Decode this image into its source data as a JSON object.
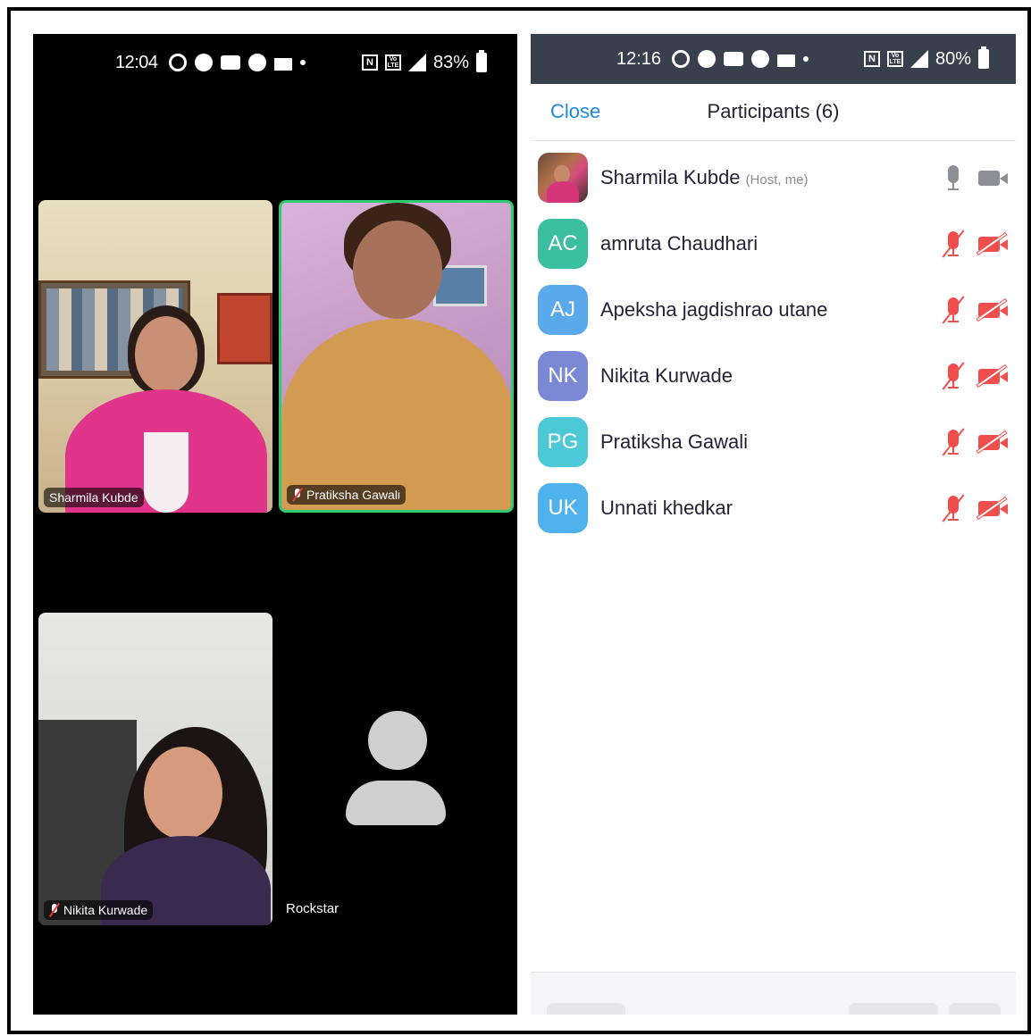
{
  "left_phone": {
    "status": {
      "time": "12:04",
      "battery": "83%"
    },
    "tiles": [
      {
        "name": "Sharmila Kubde",
        "muted": false,
        "active_speaker": false
      },
      {
        "name": "Pratiksha Gawali",
        "muted": true,
        "active_speaker": true
      },
      {
        "name": "Nikita Kurwade",
        "muted": true,
        "active_speaker": false
      },
      {
        "name": "Rockstar",
        "muted": false,
        "video": false
      }
    ]
  },
  "right_phone": {
    "status": {
      "time": "12:16",
      "battery": "80%"
    },
    "header": {
      "close_label": "Close",
      "title": "Participants (6)"
    },
    "participants": [
      {
        "initials": "",
        "name": "Sharmila Kubde",
        "tag": "(Host, me)",
        "avatar_color": "",
        "mic": "on",
        "video": "on"
      },
      {
        "initials": "AC",
        "name": "amruta Chaudhari",
        "tag": "",
        "avatar_color": "#3cbfa0",
        "mic": "muted",
        "video": "off"
      },
      {
        "initials": "AJ",
        "name": "Apeksha jagdishrao utane",
        "tag": "",
        "avatar_color": "#5aa9ea",
        "mic": "muted",
        "video": "off"
      },
      {
        "initials": "NK",
        "name": "Nikita Kurwade",
        "tag": "",
        "avatar_color": "#7b88d6",
        "mic": "muted",
        "video": "off"
      },
      {
        "initials": "PG",
        "name": "Pratiksha Gawali",
        "tag": "",
        "avatar_color": "#4dc8d6",
        "mic": "muted",
        "video": "off"
      },
      {
        "initials": "UK",
        "name": "Unnati khedkar",
        "tag": "",
        "avatar_color": "#4fb2ec",
        "mic": "muted",
        "video": "off"
      }
    ]
  },
  "colors": {
    "accent": "#1e88e5",
    "active_speaker_border": "#2ecc71",
    "muted_red": "#f04d4d",
    "status_bar_dark": "#3a3f4e"
  }
}
